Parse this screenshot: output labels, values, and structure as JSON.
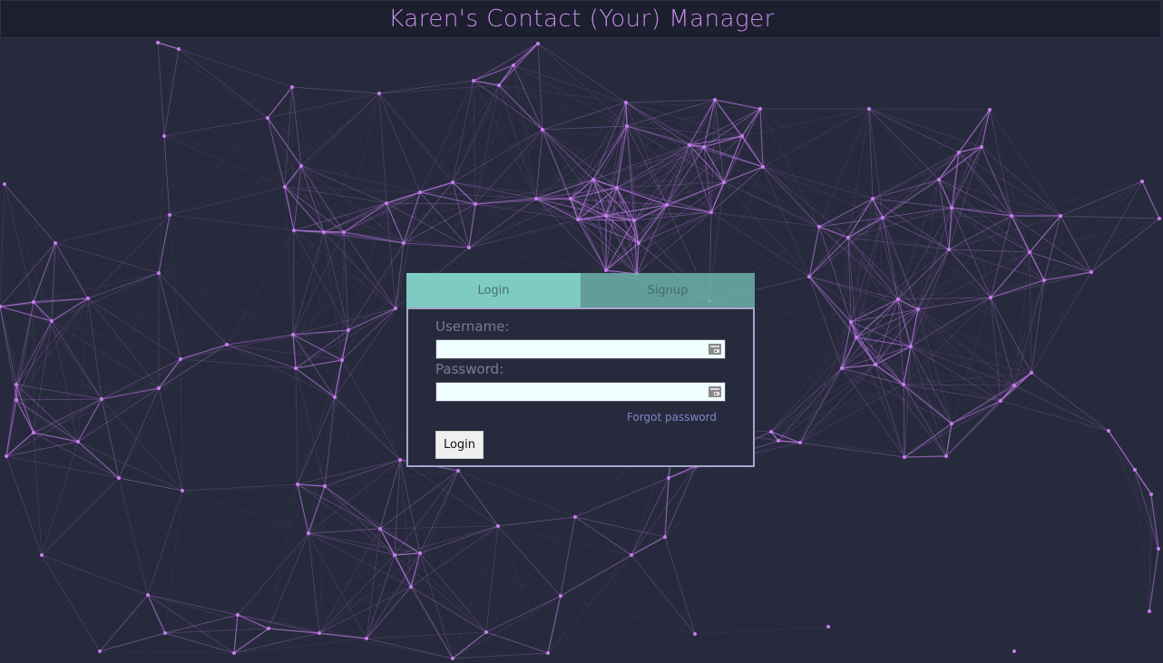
{
  "header": {
    "title": "Karen's Contact (Your) Manager"
  },
  "auth": {
    "tabs": [
      {
        "label": "Login",
        "active": true
      },
      {
        "label": "Signup",
        "active": false
      }
    ],
    "username_label": "Username:",
    "username_value": "",
    "password_label": "Password:",
    "password_value": "",
    "field_icon": "autofill-key-icon",
    "forgot_label": "Forgot password",
    "submit_label": "Login"
  },
  "colors": {
    "background": "#272a3c",
    "header_bg": "#1c1f2d",
    "title": "#c98cec",
    "network_line": "#c77ef0",
    "tab_active": "#7ecbc2",
    "tab_inactive": "#6db2aa",
    "form_border": "#a7a5d0",
    "input_bg": "#effefe",
    "link": "#7e86c6"
  },
  "background_decoration": "particle-network"
}
